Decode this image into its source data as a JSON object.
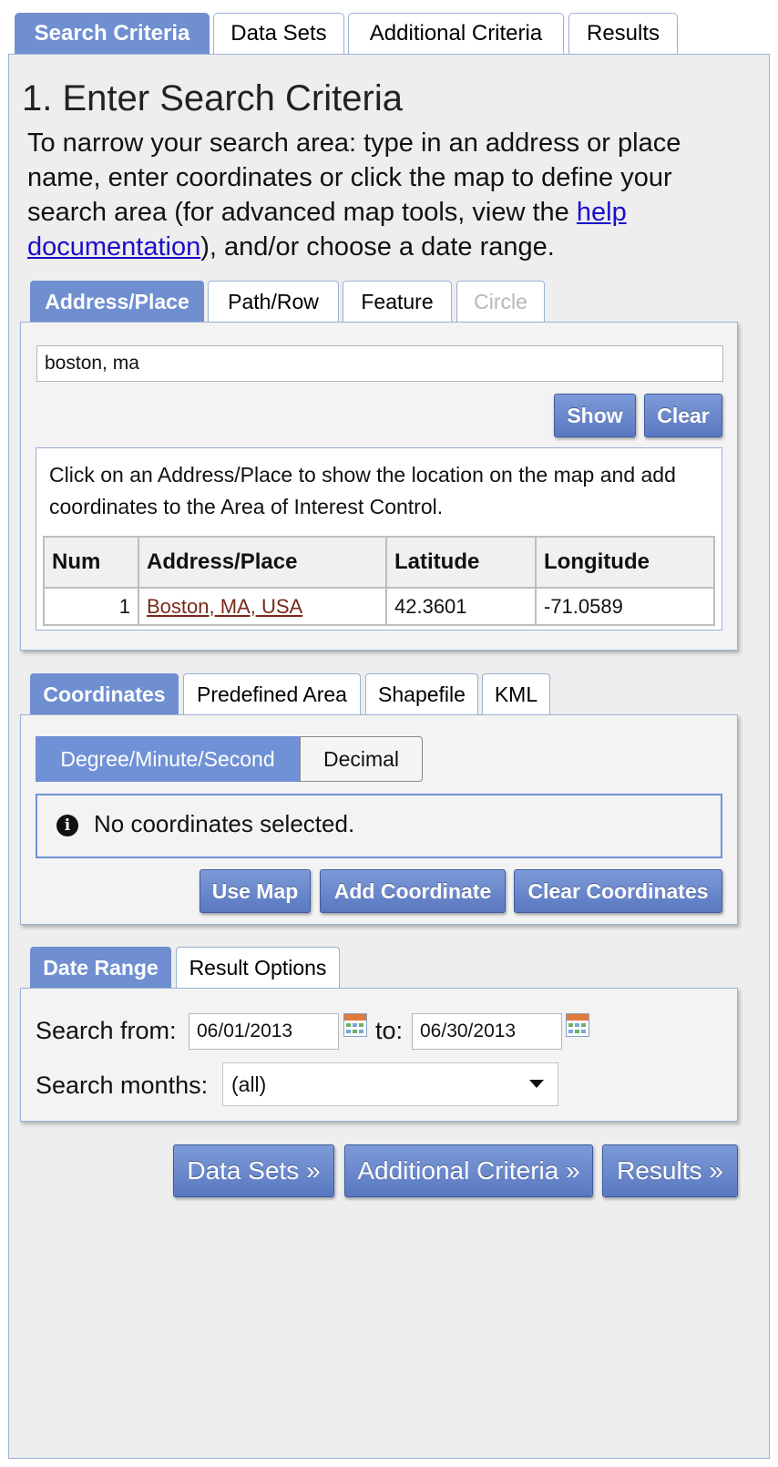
{
  "main_tabs": [
    {
      "label": "Search Criteria",
      "active": true
    },
    {
      "label": "Data Sets",
      "active": false
    },
    {
      "label": "Additional Criteria",
      "active": false
    },
    {
      "label": "Results",
      "active": false
    }
  ],
  "page": {
    "title": "1. Enter Search Criteria",
    "intro_before_link": "To narrow your search area: type in an address or place name, enter coordinates or click the map to define your search area (for advanced map tools, view the ",
    "intro_link": "help documentation",
    "intro_after_link": "), and/or choose a date range."
  },
  "area_tabs": [
    {
      "label": "Address/Place",
      "state": "active"
    },
    {
      "label": "Path/Row",
      "state": "normal"
    },
    {
      "label": "Feature",
      "state": "normal"
    },
    {
      "label": "Circle",
      "state": "disabled"
    }
  ],
  "address": {
    "search_value": "boston, ma",
    "show_label": "Show",
    "clear_label": "Clear",
    "note": "Click on an Address/Place to show the location on the map and add coordinates to the Area of Interest Control.",
    "columns": [
      "Num",
      "Address/Place",
      "Latitude",
      "Longitude"
    ],
    "rows": [
      {
        "num": "1",
        "place": "Boston, MA, USA",
        "latitude": "42.3601",
        "longitude": "-71.0589"
      }
    ]
  },
  "coord_tabs": [
    {
      "label": "Coordinates",
      "state": "active"
    },
    {
      "label": "Predefined Area",
      "state": "normal"
    },
    {
      "label": "Shapefile",
      "state": "normal"
    },
    {
      "label": "KML",
      "state": "normal"
    }
  ],
  "coordinates": {
    "format_options": [
      {
        "label": "Degree/Minute/Second",
        "selected": true
      },
      {
        "label": "Decimal",
        "selected": false
      }
    ],
    "info_icon": "info-icon",
    "empty_message": "No coordinates selected.",
    "use_map_label": "Use Map",
    "add_label": "Add Coordinate",
    "clear_label": "Clear Coordinates"
  },
  "date_tabs": [
    {
      "label": "Date Range",
      "state": "active"
    },
    {
      "label": "Result Options",
      "state": "normal"
    }
  ],
  "date_range": {
    "from_label": "Search from:",
    "from_value": "06/01/2013",
    "to_label": "to:",
    "to_value": "06/30/2013",
    "calendar_icon": "calendar-icon",
    "months_label": "Search months:",
    "months_value": "(all)"
  },
  "nav_buttons": {
    "data_sets": "Data Sets »",
    "additional_criteria": "Additional Criteria »",
    "results": "Results »"
  },
  "colors": {
    "accent": "#6f8fd1",
    "link": "#1a0dcc",
    "place_link": "#7a2a1a",
    "panel_border": "#9bb1d6"
  }
}
